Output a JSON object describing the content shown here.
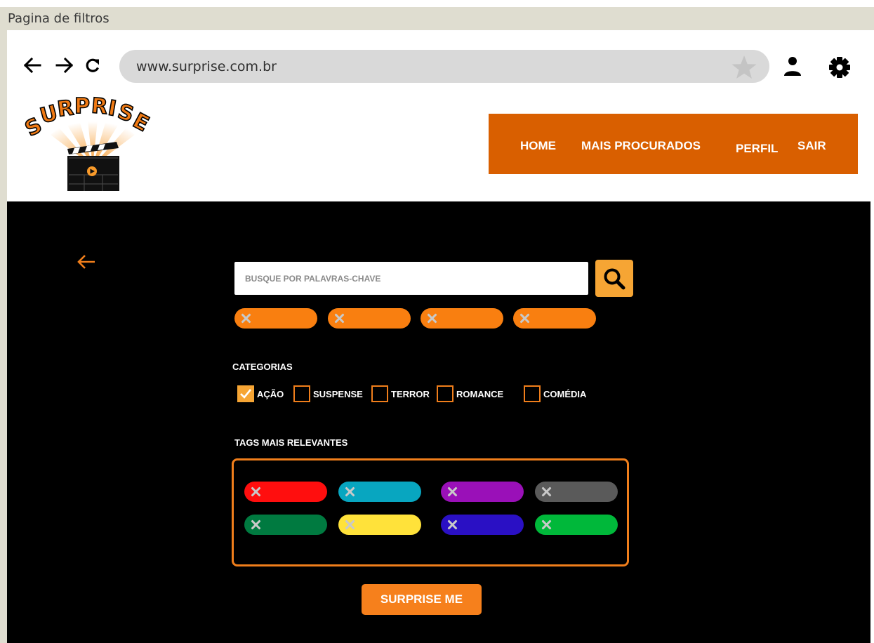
{
  "window": {
    "title": "Pagina de filtros"
  },
  "browser": {
    "url": "www.surprise.com.br",
    "icons": [
      "back-arrow-icon",
      "forward-arrow-icon",
      "reload-icon",
      "star-icon",
      "user-icon",
      "gear-icon"
    ]
  },
  "header": {
    "logo_text": "SURPRISE",
    "nav": {
      "home": "HOME",
      "mais_procurados": "MAIS PROCURADOS",
      "perfil": "PERFIL",
      "sair": "SAIR"
    },
    "nav_color": "#d95f00"
  },
  "filters": {
    "search_placeholder": "BUSQUE POR PALAVRAS-CHAVE",
    "selected_chip_color": "#f97f10",
    "selected_chip_count": 4,
    "categories_label": "CATEGORIAS",
    "categories": [
      {
        "label": "AÇÃO",
        "checked": true
      },
      {
        "label": "SUSPENSE",
        "checked": false
      },
      {
        "label": "TERROR",
        "checked": false
      },
      {
        "label": "ROMANCE",
        "checked": false
      },
      {
        "label": "COMÉDIA",
        "checked": false
      }
    ],
    "tags_label": "TAGS MAIS RELEVANTES",
    "tag_colors": [
      "#ff0e0e",
      "#08a6c0",
      "#9a10b8",
      "#5a5a5a",
      "#007a40",
      "#ffe23a",
      "#2a10c4",
      "#00b83a"
    ],
    "submit_label": "SURPRISE ME"
  },
  "colors": {
    "accent": "#f07e1b",
    "background": "#000000",
    "button": "#f6801c",
    "search_button": "#f6a534"
  }
}
